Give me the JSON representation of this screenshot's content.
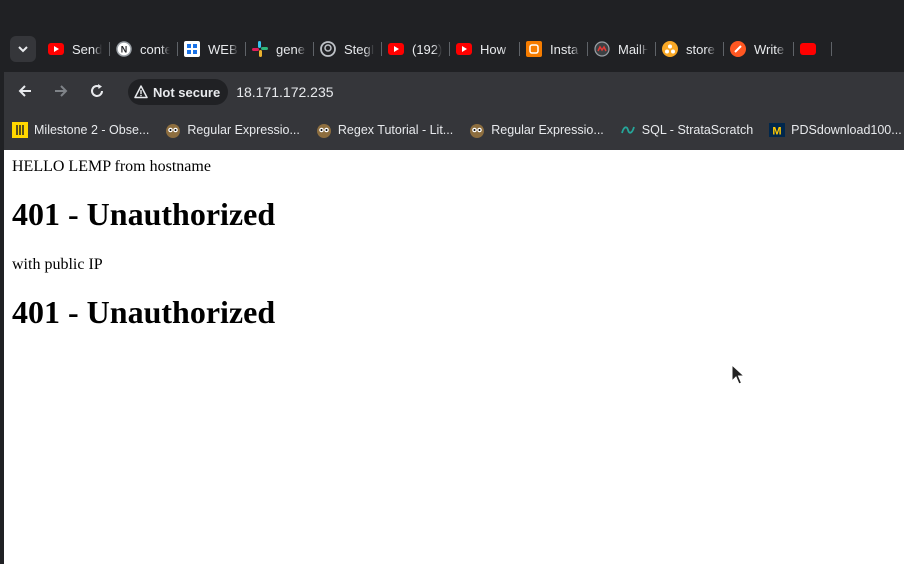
{
  "tabs": [
    {
      "title": "Send",
      "icon": "youtube-icon"
    },
    {
      "title": "conte",
      "icon": "notion-n-icon"
    },
    {
      "title": "WEB",
      "icon": "blue-grid-icon"
    },
    {
      "title": "gener",
      "icon": "slack-icon"
    },
    {
      "title": "StegI",
      "icon": "github-icon"
    },
    {
      "title": "(192)",
      "icon": "youtube-icon"
    },
    {
      "title": "How",
      "icon": "youtube-icon"
    },
    {
      "title": "Insta",
      "icon": "orange-app-icon"
    },
    {
      "title": "MailH",
      "icon": "mail-icon"
    },
    {
      "title": "store",
      "icon": "orange-circle-icon"
    },
    {
      "title": "Write",
      "icon": "orange-pen-icon"
    }
  ],
  "toolbar": {
    "security_label": "Not secure",
    "url": "18.171.172.235"
  },
  "bookmarks": [
    {
      "label": "Milestone 2 - Obse...",
      "icon": "yellow-bookmark-icon"
    },
    {
      "label": "Regular Expressio...",
      "icon": "owl-icon"
    },
    {
      "label": "Regex Tutorial - Lit...",
      "icon": "owl-icon"
    },
    {
      "label": "Regular Expressio...",
      "icon": "owl-icon"
    },
    {
      "label": "SQL - StrataScratch",
      "icon": "stratascratch-icon"
    },
    {
      "label": "PDSdownload100...",
      "icon": "michigan-m-icon"
    }
  ],
  "page": {
    "line1": "HELLO LEMP from hostname",
    "heading1": "401 - Unauthorized",
    "line2": "with public IP",
    "heading2": "401 - Unauthorized"
  },
  "colors": {
    "frame": "#202124",
    "toolbar": "#35363a",
    "page_bg": "#ffffff",
    "youtube_red": "#ff0000"
  }
}
